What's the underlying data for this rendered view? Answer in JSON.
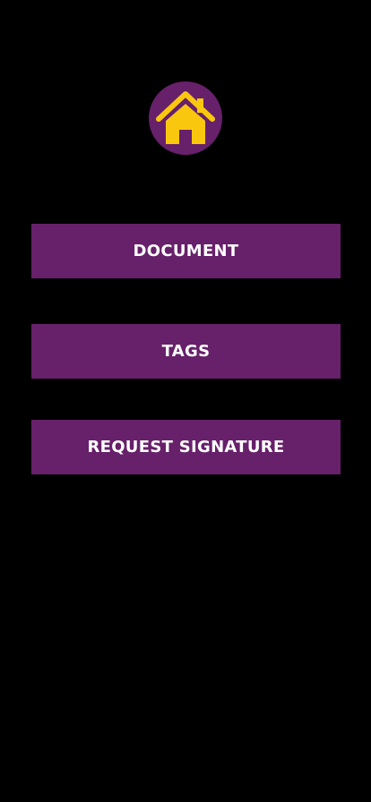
{
  "header": {
    "logo_icon": "home-icon"
  },
  "menu": {
    "document_label": "DOCUMENT",
    "tags_label": "TAGS",
    "request_signature_label": "REQUEST SIGNATURE"
  },
  "colors": {
    "background": "#000000",
    "accent_purple": "#67206a",
    "icon_yellow": "#f9c80e",
    "button_text": "#ffffff"
  }
}
